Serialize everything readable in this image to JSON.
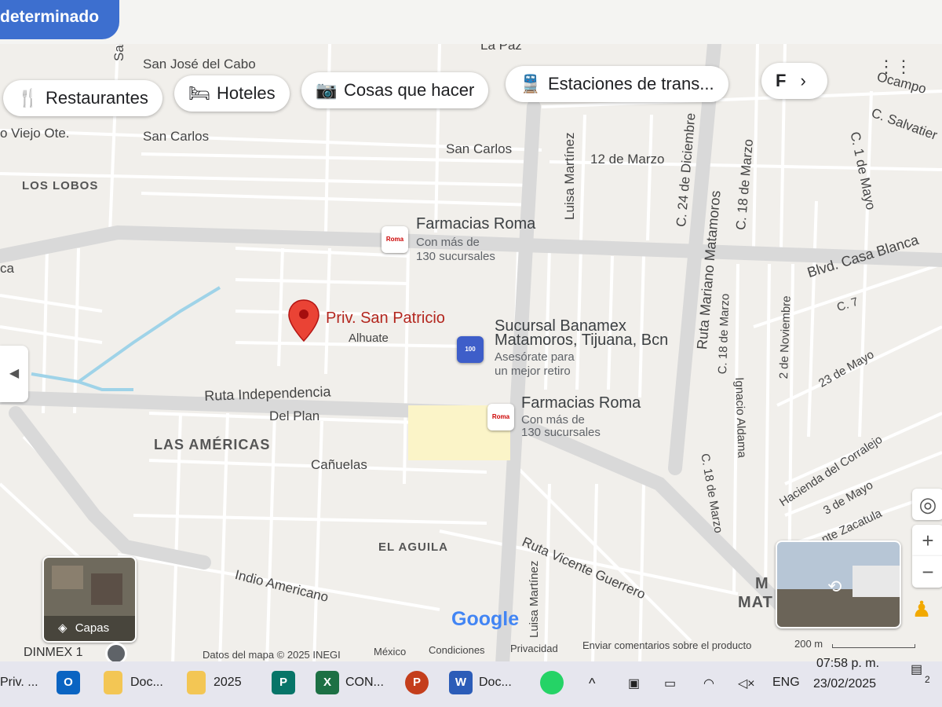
{
  "top": {
    "mode_label": "determinado"
  },
  "chips": [
    {
      "label": "Restaurantes",
      "icon": "restaurant-icon"
    },
    {
      "label": "Hoteles",
      "icon": "bed-icon"
    },
    {
      "label": "Cosas que hacer",
      "icon": "camera-icon"
    },
    {
      "label": "Estaciones de trans...",
      "icon": "train-icon"
    },
    {
      "label": "F",
      "icon": ""
    }
  ],
  "map": {
    "streets": {
      "la_paz": "La Paz",
      "san_jose_del_cabo": "San José del Cabo",
      "san_vertical": "San",
      "viejo_ote": "o Viejo Ote.",
      "san_carlos_1": "San Carlos",
      "san_carlos_2": "San Carlos",
      "doce_marzo": "12 de Marzo",
      "luisa_martinez_top": "Luisa Martínez",
      "c24_diciembre": "C. 24 de Diciembre",
      "c18_marzo_top": "C. 18 de Marzo",
      "ruta_mariano_matamoros": "Ruta Mariano Matamoros",
      "c1_mayo": "C. 1 de Mayo",
      "c_salvatierra": "C. Salvatier",
      "ocampo": "Ocampo",
      "blvd_casa_blanca": "Blvd. Casa Blanca",
      "ca": "ca",
      "alhuate": "Alhuate",
      "c18_marzo_mid": "C. 18 de Marzo",
      "ignacio_aldama": "Ignacio Aldama",
      "dos_noviembre": "2 de Noviembre",
      "c7": "C. 7",
      "veintitres_mayo": "23 de Mayo",
      "ruta_independencia": "Ruta Independencia",
      "del_plan": "Del Plan",
      "canuelas": "Cañuelas",
      "c18_marzo_bottom": "C. 18 de Marzo",
      "hacienda_corralejo": "Hacienda del Corralejo",
      "tres_mayo": "3 de Mayo",
      "zacatula": "nte Zacatula",
      "ruta_vicente_guerrero": "Ruta Vicente Guerrero",
      "luisa_martinez_bottom": "Luisa Martínez",
      "indio_americano": "Indio Americano",
      "mat": "MAT",
      "m": "M",
      "dinmex": "DINMEX 1"
    },
    "areas": {
      "los_lobos": "LOS LOBOS",
      "las_americas": "LAS AMÉRICAS",
      "el_aguila": "EL AGUILA"
    },
    "pin": {
      "title": "Priv. San Patricio",
      "color": "#ea4335"
    },
    "pois": [
      {
        "title": "Farmacias Roma",
        "line1": "Con más de",
        "line2": "130 sucursales",
        "icon": "pharmacy-logo-icon"
      },
      {
        "title": "Sucursal Banamex",
        "title2": "Matamoros, Tijuana, Bcn",
        "line1": "Asesórate para",
        "line2": "un mejor retiro",
        "icon": "atm-icon"
      },
      {
        "title": "Farmacias Roma",
        "line1": "Con más de",
        "line2": "130 sucursales",
        "icon": "pharmacy-logo-icon"
      }
    ],
    "pharmacy_logo_text": "Roma",
    "atm_text": "100",
    "layers_label": "Capas",
    "google_logo": "Google",
    "scale_label": "200 m",
    "footer": {
      "map_data": "Datos del mapa © 2025 INEGI",
      "country": "México",
      "terms": "Condiciones",
      "privacy": "Privacidad",
      "feedback": "Enviar comentarios sobre el producto"
    }
  },
  "taskbar": {
    "items": [
      {
        "label": "Priv. ..."
      },
      {
        "label": "Doc..."
      },
      {
        "label": "2025"
      },
      {
        "label": "CON..."
      },
      {
        "label": "Doc..."
      }
    ],
    "app_letters": {
      "outlook": "O",
      "publisher": "P",
      "excel": "X",
      "powerpoint": "P",
      "word": "W"
    },
    "lang": "ENG",
    "time": "07:58 p. m.",
    "date": "23/02/2025",
    "notif_count": "2"
  },
  "colors": {
    "accent": "#3d6fcf",
    "road": "#ffffff",
    "main_road": "#d9d9d9",
    "water": "#9fd3e8"
  }
}
